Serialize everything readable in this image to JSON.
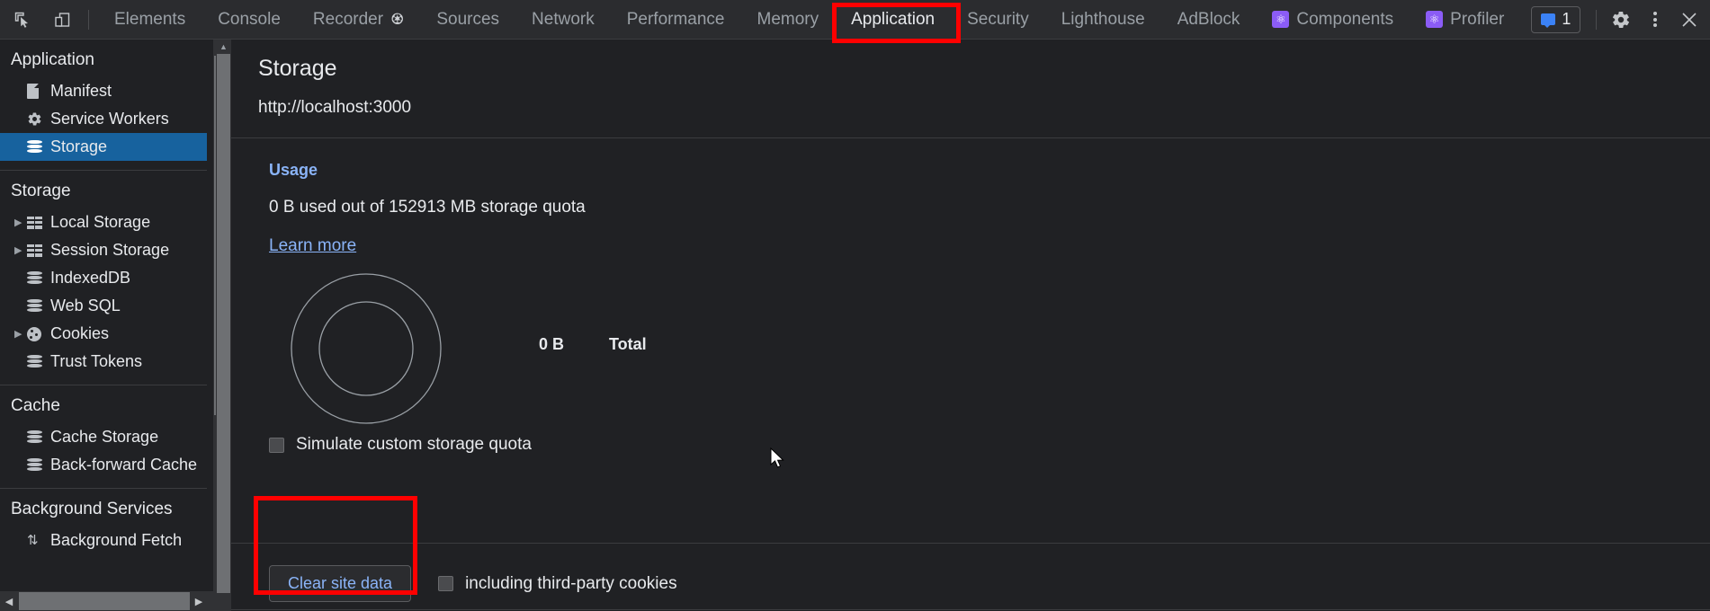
{
  "toolbar": {
    "left_icons": [
      {
        "name": "inspect-element-icon",
        "label": "Inspect element"
      },
      {
        "name": "device-toolbar-icon",
        "label": "Toggle device toolbar"
      }
    ],
    "tabs": [
      {
        "label": "Elements",
        "active": false,
        "icon": null
      },
      {
        "label": "Console",
        "active": false,
        "icon": null
      },
      {
        "label": "Recorder",
        "active": false,
        "icon": "flask-icon"
      },
      {
        "label": "Sources",
        "active": false,
        "icon": null
      },
      {
        "label": "Network",
        "active": false,
        "icon": null
      },
      {
        "label": "Performance",
        "active": false,
        "icon": null
      },
      {
        "label": "Memory",
        "active": false,
        "icon": null
      },
      {
        "label": "Application",
        "active": true,
        "icon": null
      },
      {
        "label": "Security",
        "active": false,
        "icon": null
      },
      {
        "label": "Lighthouse",
        "active": false,
        "icon": null
      },
      {
        "label": "AdBlock",
        "active": false,
        "icon": null
      },
      {
        "label": "Components",
        "active": false,
        "icon": "react-icon"
      },
      {
        "label": "Profiler",
        "active": false,
        "icon": "react-icon"
      }
    ],
    "message_badge_count": "1",
    "settings_label": "Settings",
    "more_label": "More options",
    "close_label": "Close DevTools"
  },
  "sidebar": {
    "groups": [
      {
        "title": "Application",
        "items": [
          {
            "label": "Manifest",
            "icon": "document-icon",
            "expandable": false,
            "selected": false
          },
          {
            "label": "Service Workers",
            "icon": "gear-icon",
            "expandable": false,
            "selected": false
          },
          {
            "label": "Storage",
            "icon": "database-icon",
            "expandable": false,
            "selected": true
          }
        ]
      },
      {
        "title": "Storage",
        "items": [
          {
            "label": "Local Storage",
            "icon": "table-icon",
            "expandable": true,
            "selected": false
          },
          {
            "label": "Session Storage",
            "icon": "table-icon",
            "expandable": true,
            "selected": false
          },
          {
            "label": "IndexedDB",
            "icon": "database-icon",
            "expandable": false,
            "selected": false
          },
          {
            "label": "Web SQL",
            "icon": "database-icon",
            "expandable": false,
            "selected": false
          },
          {
            "label": "Cookies",
            "icon": "cookie-icon",
            "expandable": true,
            "selected": false
          },
          {
            "label": "Trust Tokens",
            "icon": "database-icon",
            "expandable": false,
            "selected": false
          }
        ]
      },
      {
        "title": "Cache",
        "items": [
          {
            "label": "Cache Storage",
            "icon": "database-icon",
            "expandable": false,
            "selected": false
          },
          {
            "label": "Back-forward Cache",
            "icon": "database-icon",
            "expandable": false,
            "selected": false
          }
        ]
      },
      {
        "title": "Background Services",
        "items": [
          {
            "label": "Background Fetch",
            "icon": "updown-arrows-icon",
            "expandable": false,
            "selected": false
          }
        ]
      }
    ]
  },
  "main": {
    "title": "Storage",
    "origin": "http://localhost:3000",
    "usage": {
      "heading": "Usage",
      "summary": "0 B used out of 152913 MB storage quota",
      "learn_more": "Learn more",
      "legend_value": "0 B",
      "legend_label": "Total"
    },
    "simulate_quota_label": "Simulate custom storage quota",
    "simulate_quota_checked": false,
    "clear_button_label": "Clear site data",
    "third_party_label": "including third-party cookies",
    "third_party_checked": false
  },
  "chart_data": {
    "type": "pie",
    "title": "Storage usage",
    "categories": [
      "Total"
    ],
    "values": [
      0
    ],
    "value_labels": [
      "0 B"
    ],
    "total": "0 B",
    "quota": "152913 MB",
    "legend_position": "right",
    "grid": false,
    "note": "Donut chart rendered empty; 0 B of quota used"
  },
  "annotations": {
    "boxes": [
      {
        "name": "application-tab-highlight",
        "color": "#ff0000"
      },
      {
        "name": "clear-site-data-highlight",
        "color": "#ff0000"
      }
    ]
  }
}
